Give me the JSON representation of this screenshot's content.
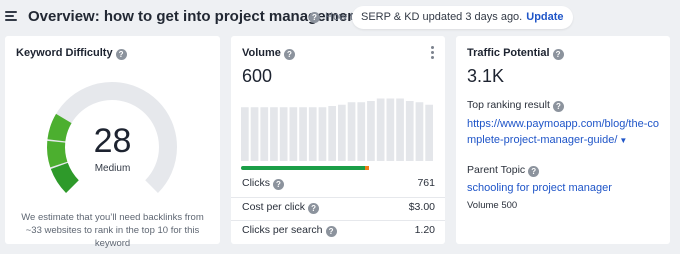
{
  "header": {
    "title": "Overview: how to get into project management",
    "howto_text": "How to",
    "notice_text": "SERP & KD updated 3 days ago.",
    "update_label": "Update"
  },
  "kd_card": {
    "title": "Keyword Difficulty",
    "value": "28",
    "level": "Medium",
    "value_fraction": 0.28,
    "note": "We estimate that you’ll need backlinks from ~33 websites to rank in the top 10 for this keyword",
    "colors": {
      "filled": "#4caf2f",
      "filled_dark": "#2e9a2a",
      "empty": "#e6e8ec"
    }
  },
  "volume_card": {
    "title": "Volume",
    "value": "600",
    "trend_values": [
      430,
      430,
      430,
      430,
      430,
      430,
      430,
      430,
      430,
      440,
      450,
      470,
      470,
      480,
      500,
      500,
      500,
      480,
      470,
      450
    ],
    "clicks_fraction": 0.8,
    "metrics": [
      {
        "label": "Clicks",
        "value": "761"
      },
      {
        "label": "Cost per click",
        "value": "$3.00"
      },
      {
        "label": "Clicks per search",
        "value": "1.20"
      }
    ]
  },
  "traffic_card": {
    "title": "Traffic Potential",
    "value": "3.1K",
    "top_result_label": "Top ranking result",
    "top_result_url": "https://www.paymoapp.com/blog/the-complete-project-manager-guide/",
    "parent_topic_label": "Parent Topic",
    "parent_topic": "schooling for project manager",
    "parent_volume": "Volume 500"
  }
}
